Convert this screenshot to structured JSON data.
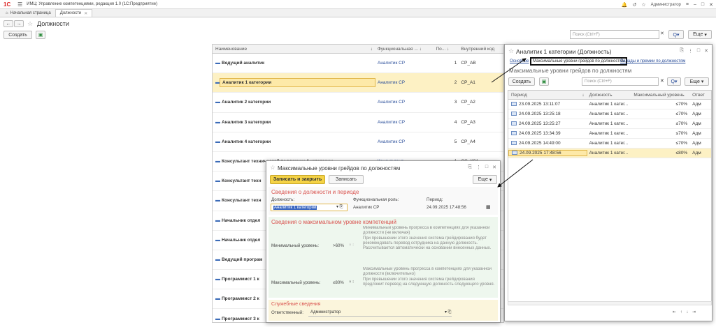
{
  "app": {
    "title": "ИМЦ: Управление компетенциями, редакция 1.0  (1С:Предприятие)",
    "user": "Администратор"
  },
  "tabs": [
    {
      "label": "Начальная страница"
    },
    {
      "label": "Должности"
    }
  ],
  "page": {
    "title": "Должности",
    "create_label": "Создать",
    "search_placeholder": "Поиск (Ctrl+F)",
    "more_label": "Еще",
    "search_btn": "Q"
  },
  "table": {
    "headers": [
      "Наименование",
      "Функциональная ...",
      "По...",
      "Внутренний код"
    ],
    "rows": [
      {
        "name": "Ведущий аналитик",
        "role": "Аналитик СР",
        "order": "1",
        "code": "СР_АВ"
      },
      {
        "name": "Аналитик 1 категории",
        "role": "Аналитик СР",
        "order": "2",
        "code": "СР_А1"
      },
      {
        "name": "Аналитик 2 категории",
        "role": "Аналитик СР",
        "order": "3",
        "code": "СР_А2"
      },
      {
        "name": "Аналитик 3 категории",
        "role": "Аналитик СР",
        "order": "4",
        "code": "СР_А3"
      },
      {
        "name": "Аналитик 4 категории",
        "role": "Аналитик СР",
        "order": "5",
        "code": "СР_А4"
      },
      {
        "name": "Консультант технической поддержки 1 категории",
        "role": "Консультант",
        "order": "1",
        "code": "СС_КС1"
      },
      {
        "name": "Консультант техн",
        "role": "",
        "order": "",
        "code": ""
      },
      {
        "name": "Консультант техн",
        "role": "",
        "order": "",
        "code": ""
      },
      {
        "name": "Начальник отдел",
        "role": "",
        "order": "",
        "code": ""
      },
      {
        "name": "Начальник отдел",
        "role": "",
        "order": "",
        "code": ""
      },
      {
        "name": "Ведущий програм",
        "role": "",
        "order": "",
        "code": ""
      },
      {
        "name": "Программист 1 к",
        "role": "",
        "order": "",
        "code": ""
      },
      {
        "name": "Программист 2 к",
        "role": "",
        "order": "",
        "code": ""
      },
      {
        "name": "Программист 3 к",
        "role": "",
        "order": "",
        "code": ""
      }
    ]
  },
  "pos_window": {
    "title": "Аналитик 1 категории (Должность)",
    "nav": [
      "Основное",
      "Максимальные уровни грейдов по должностям",
      "Оклады и премии по должностям"
    ],
    "section_title": "Максимальные уровни грейдов по должностям",
    "create_label": "Создать",
    "search_placeholder": "Поиск (Ctrl+F)",
    "more_label": "Еще",
    "headers": [
      "Период",
      "Должность",
      "Максимальный уровень",
      "Ответ"
    ],
    "rows": [
      {
        "period": "23.09.2025 13:11:07",
        "position": "Аналитик 1 катег...",
        "level": "≤70%",
        "resp": "Адм"
      },
      {
        "period": "24.09.2025 13:25:18",
        "position": "Аналитик 1 катег...",
        "level": "≤70%",
        "resp": "Адм"
      },
      {
        "period": "24.09.2025 13:25:27",
        "position": "Аналитик 1 катег...",
        "level": "≤70%",
        "resp": "Адм"
      },
      {
        "period": "24.09.2025 13:34:39",
        "position": "Аналитик 1 катег...",
        "level": "≤70%",
        "resp": "Адм"
      },
      {
        "period": "24.09.2025 14:49:00",
        "position": "Аналитик 1 катег...",
        "level": "≤70%",
        "resp": "Адм"
      },
      {
        "period": "24.09.2025 17:48:56",
        "position": "Аналитик 1 катег...",
        "level": "≤80%",
        "resp": "Адм"
      }
    ]
  },
  "grade_window": {
    "title": "Максимальные уровни грейдов по должностям",
    "save_close_label": "Записать и закрыть",
    "save_label": "Записать",
    "more_label": "Еще",
    "sec1": "Сведения о должности и периоде",
    "position_label": "Должность:",
    "position_value": "Аналитик 1 категории",
    "role_label": "Функциональная роль:",
    "role_value": "Аналитик СР",
    "period_label": "Период:",
    "period_value": "24.09.2025 17:48:56",
    "sec2": "Сведения о максимальном уровне компетенций",
    "min_label": "Минимальный уровень:",
    "min_value": ">60%",
    "min_desc": "Минимальный уровень прогресса в компетенциях для указанной должности (не включая)\nПри превышении этого значения система грейдирования будет рекомендовать перевод сотрудника на данную должность.\nРассчитывается автоматически на основании внесенных данных.",
    "max_label": "Максимальный уровень:",
    "max_value": "≤80%",
    "max_desc": "Максимальный уровень прогресса в компетенциях для указанной должности (включительно)\nПри превышении этого значения система грейдирования предложит перевод на следующую должность следующего уровня.",
    "sec3": "Служебные сведения",
    "resp_label": "Ответственный:",
    "resp_value": "Администратор"
  }
}
